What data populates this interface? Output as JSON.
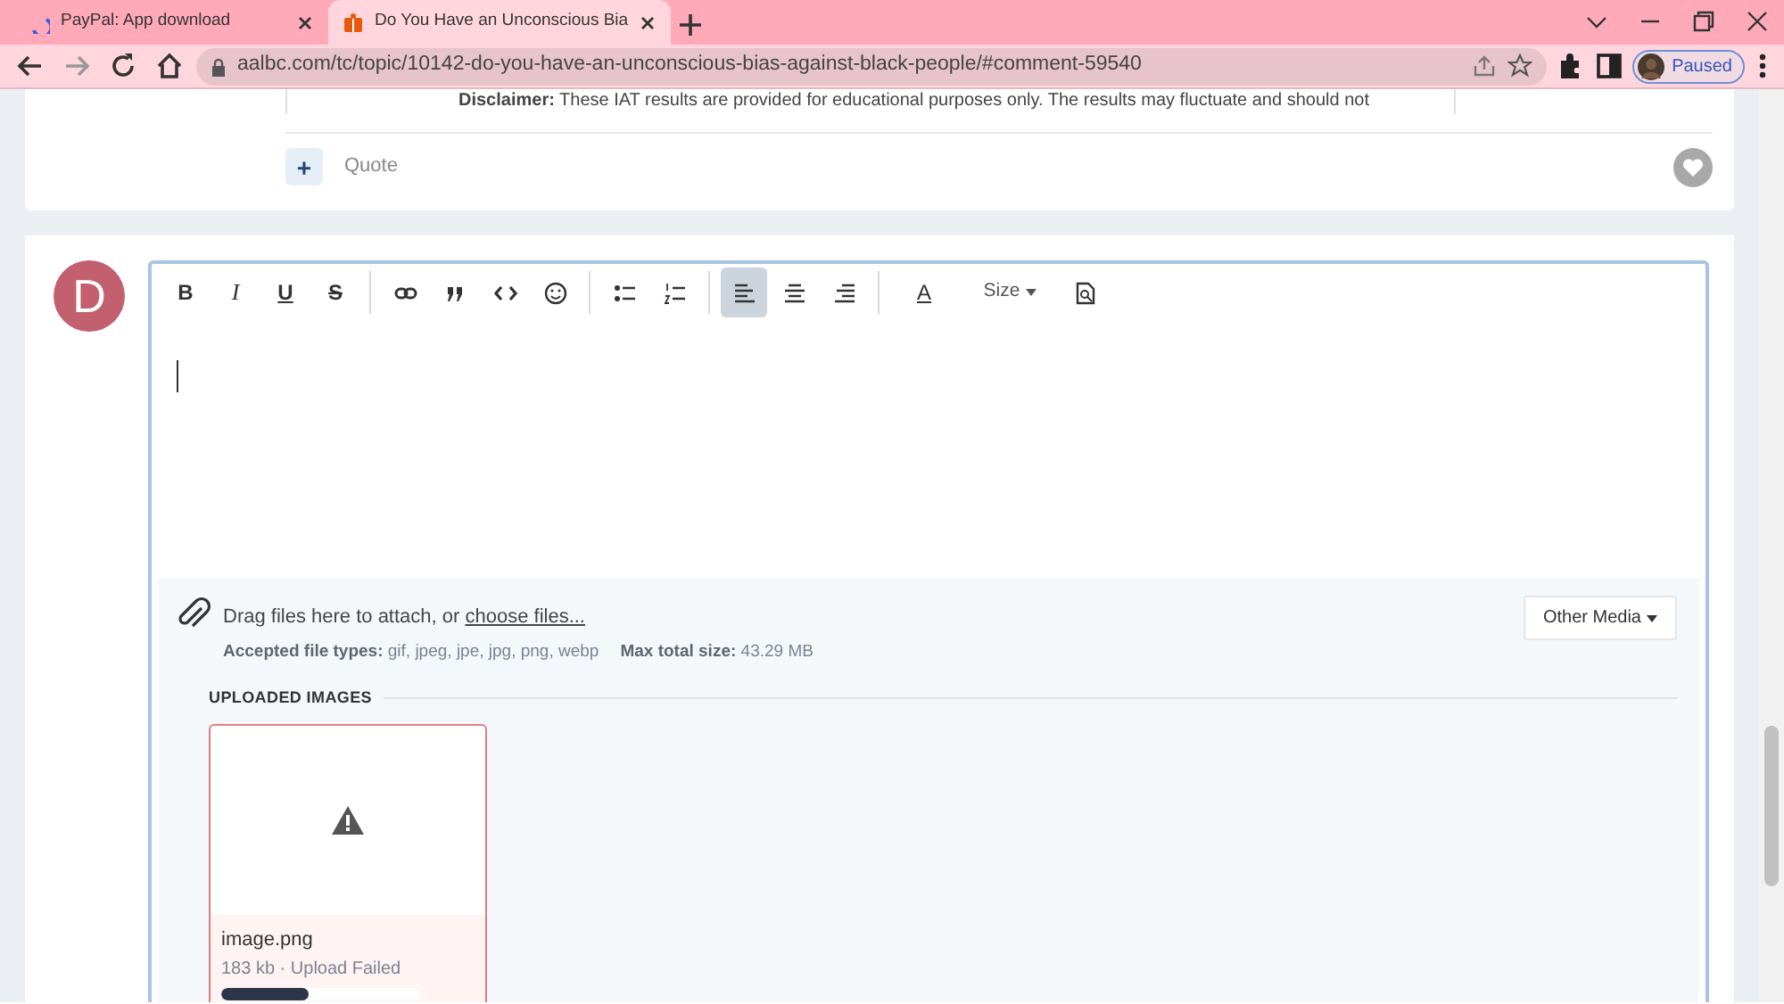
{
  "browser": {
    "tabs": [
      {
        "title": "PayPal: App download",
        "selected": false,
        "loading": true
      },
      {
        "title": "Do You Have an Unconscious Bia",
        "selected": true,
        "loading": false
      }
    ],
    "address": "aalbc.com/tc/topic/10142-do-you-have-an-unconscious-bias-against-black-people/#comment-59540",
    "profile": {
      "label": "Paused"
    }
  },
  "post": {
    "disclaimer": "**Disclaimer:** These IAT results are provided for educational purposes only. The results may fluctuate and should not",
    "quote_button": "+",
    "quote_label": "Quote"
  },
  "editor": {
    "avatar_letter": "D",
    "toolbar": [
      {
        "kind": "bold",
        "label": "B",
        "selected": false
      },
      {
        "kind": "italic",
        "label": "I",
        "selected": false
      },
      {
        "kind": "underline",
        "label": "U",
        "selected": false
      },
      {
        "kind": "strike",
        "label": "S",
        "selected": false
      },
      {
        "kind": "sep"
      },
      {
        "kind": "link",
        "selected": false
      },
      {
        "kind": "quote",
        "selected": false
      },
      {
        "kind": "code",
        "selected": false
      },
      {
        "kind": "emoji",
        "selected": false
      },
      {
        "kind": "sep"
      },
      {
        "kind": "bullets",
        "selected": false
      },
      {
        "kind": "numbers",
        "selected": false
      },
      {
        "kind": "sep"
      },
      {
        "kind": "align-left",
        "selected": true
      },
      {
        "kind": "align-center",
        "selected": false
      },
      {
        "kind": "align-right",
        "selected": false
      },
      {
        "kind": "sep"
      },
      {
        "kind": "color",
        "label": "A",
        "selected": false
      },
      {
        "kind": "size",
        "label": "Size",
        "selected": false
      },
      {
        "kind": "preview",
        "selected": false
      }
    ],
    "attach": {
      "prompt": "Drag files here to attach, or",
      "link": "choose files...",
      "types_label": "Accepted file types:",
      "types": "gif, jpeg, jpe, jpg, png, webp",
      "max_label": "Max total size:",
      "max": "43.29 MB",
      "media_button": "Other Media",
      "uploaded_heading": "UPLOADED IMAGES",
      "files": [
        {
          "name": "image.png",
          "info": "183 kb · Upload Failed",
          "failed": true,
          "level": 0.44
        }
      ]
    }
  }
}
